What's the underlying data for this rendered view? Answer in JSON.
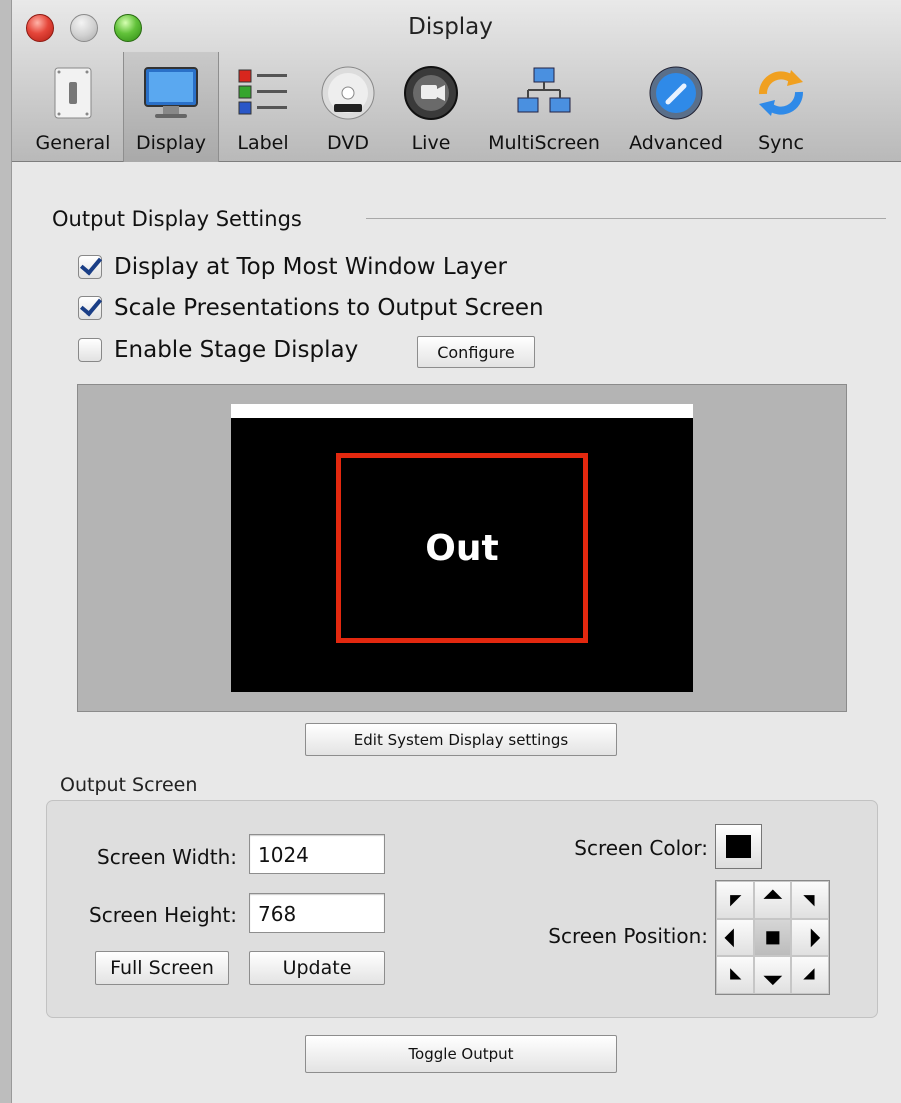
{
  "window": {
    "title": "Display"
  },
  "toolbar": [
    {
      "label": "General",
      "icon": "switch-icon"
    },
    {
      "label": "Display",
      "icon": "monitor-icon",
      "selected": true
    },
    {
      "label": "Label",
      "icon": "color-list-icon"
    },
    {
      "label": "DVD",
      "icon": "dvd-disc-icon"
    },
    {
      "label": "Live",
      "icon": "camera-icon"
    },
    {
      "label": "MultiScreen",
      "icon": "network-icon"
    },
    {
      "label": "Advanced",
      "icon": "gear-disc-icon"
    },
    {
      "label": "Sync",
      "icon": "sync-arrows-icon"
    }
  ],
  "output_display": {
    "heading": "Output Display Settings",
    "top_most": {
      "label": "Display at Top Most Window Layer",
      "checked": true
    },
    "scale": {
      "label": "Scale Presentations to Output Screen",
      "checked": true
    },
    "stage": {
      "label": "Enable Stage Display",
      "checked": false
    },
    "configure_label": "Configure",
    "preview_text": "Out",
    "preview_box_color": "#e3280f",
    "edit_system_label": "Edit System Display settings"
  },
  "output_screen": {
    "heading": "Output Screen",
    "width_label": "Screen Width:",
    "width_value": "1024",
    "height_label": "Screen Height:",
    "height_value": "768",
    "full_screen_label": "Full Screen",
    "update_label": "Update",
    "color_label": "Screen Color:",
    "screen_color": "#000000",
    "position_label": "Screen Position:"
  },
  "toggle_output_label": "Toggle Output"
}
